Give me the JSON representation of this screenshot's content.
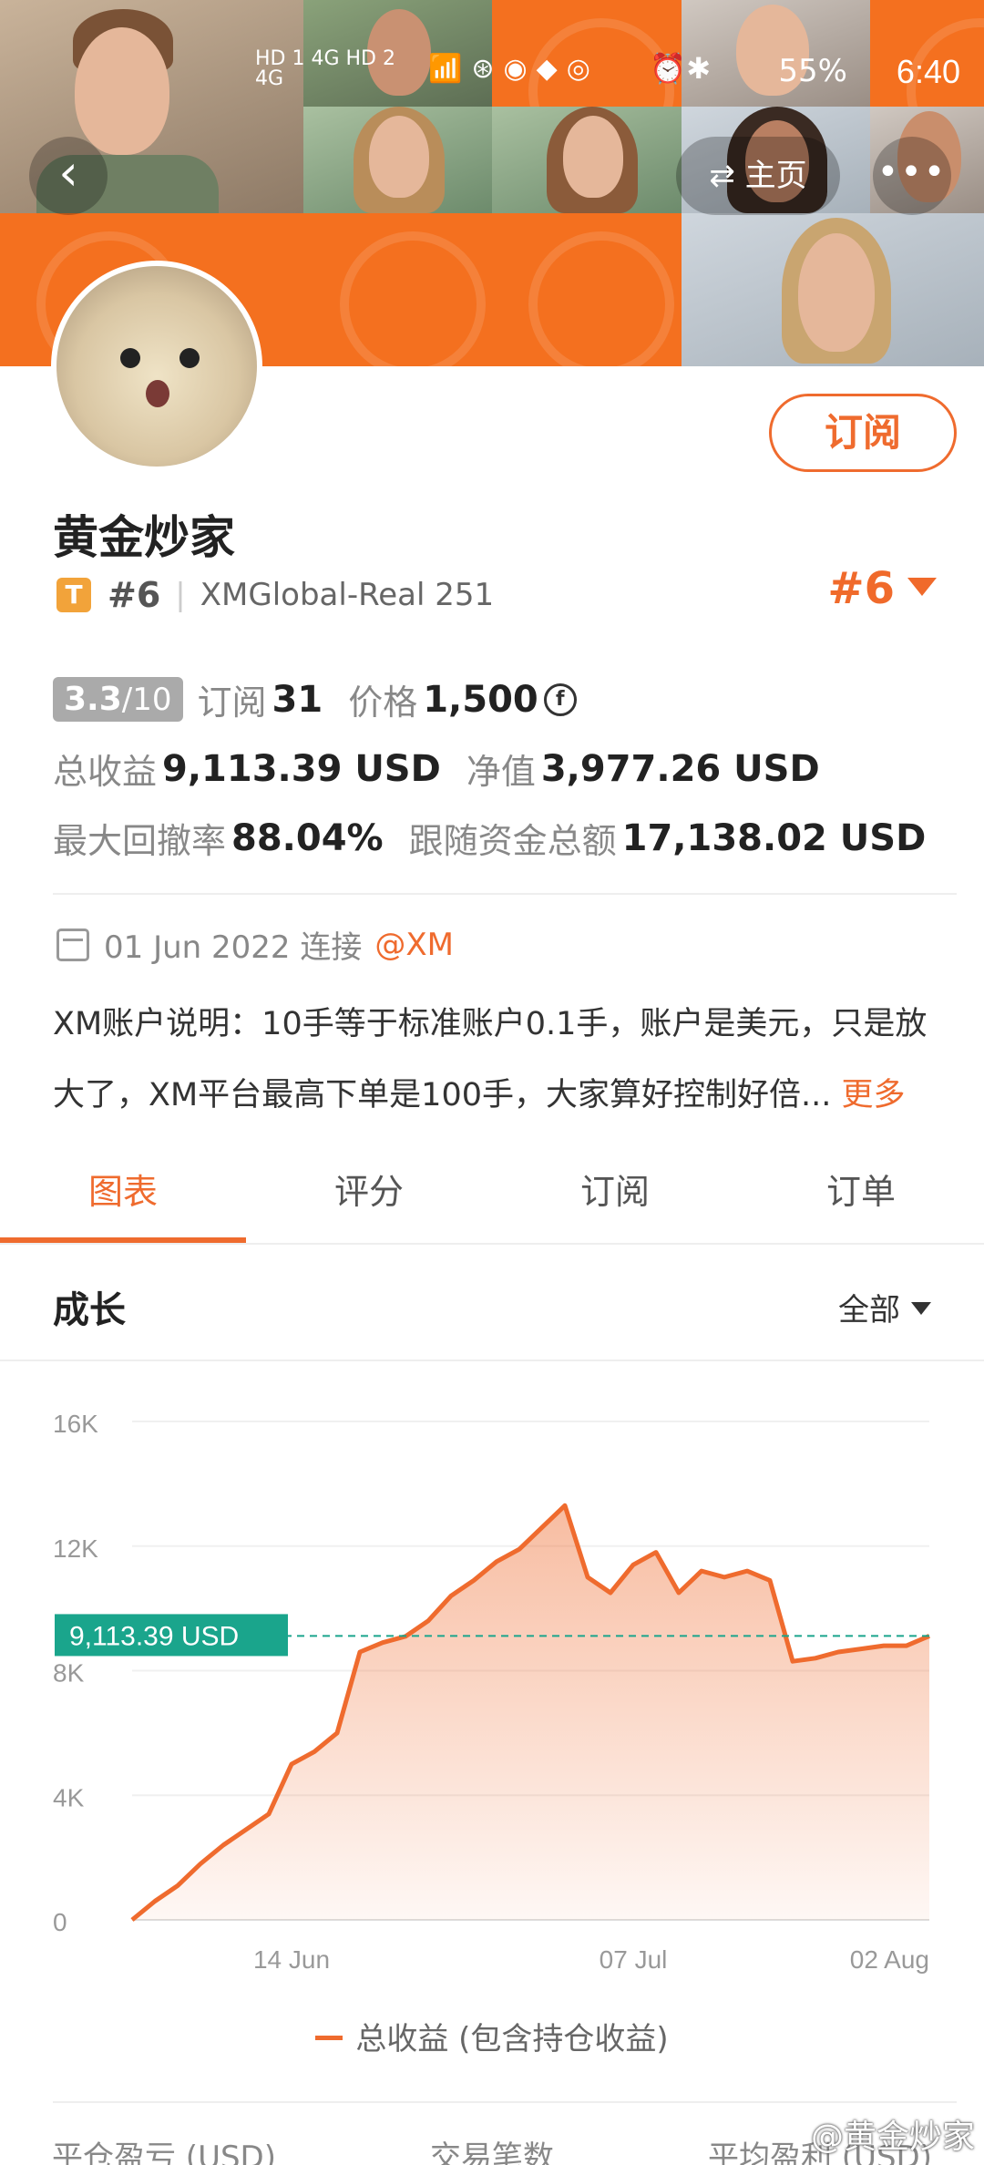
{
  "status_bar": {
    "time": "6:40",
    "battery": "55%",
    "network": "HD 1 4G HD 2 4G"
  },
  "header": {
    "home_label": "主页",
    "subscribe_label": "订阅"
  },
  "profile": {
    "name": "黄金炒家",
    "badge": "T",
    "rank": "#6",
    "account": "XMGlobal-Real 251",
    "rank_right": "#6"
  },
  "stats": {
    "score_main": "3.3",
    "score_total": "/10",
    "subscribe_label": "订阅",
    "subscribe_count": "31",
    "price_label": "价格",
    "price_value": "1,500",
    "price_icon": "f",
    "total_profit_label": "总收益",
    "total_profit_value": "9,113.39 USD",
    "net_value_label": "净值",
    "net_value_value": "3,977.26 USD",
    "max_drawdown_label": "最大回撤率",
    "max_drawdown_value": "88.04%",
    "follow_total_label": "跟随资金总额",
    "follow_total_value": "17,138.02 USD"
  },
  "info": {
    "date": "01 Jun 2022 连接",
    "broker": "@XM",
    "description": "XM账户说明：10手等于标准账户0.1手，账户是美元，只是放大了，XM平台最高下单是100手，大家算好控制好倍...",
    "more": "更多"
  },
  "tabs": [
    "图表",
    "评分",
    "订阅",
    "订单"
  ],
  "section": {
    "title": "成长",
    "filter": "全部"
  },
  "chart_data": {
    "type": "area",
    "title": "",
    "y_ticks": [
      "0",
      "4K",
      "8K",
      "12K",
      "16K"
    ],
    "x_ticks": [
      "14 Jun",
      "07 Jul",
      "02 Aug"
    ],
    "ylim": [
      0,
      16000
    ],
    "current_label": "9,113.39 USD",
    "current_value": 9113.39,
    "color": "#ef6b2e",
    "ref_line_color": "#1aa58c",
    "legend": "总收益 (包含持仓收益)",
    "series": [
      {
        "name": "总收益 (包含持仓收益)",
        "x": [
          "01 Jun",
          "03 Jun",
          "05 Jun",
          "07 Jun",
          "09 Jun",
          "11 Jun",
          "13 Jun",
          "14 Jun",
          "15 Jun",
          "16 Jun",
          "17 Jun",
          "19 Jun",
          "21 Jun",
          "23 Jun",
          "25 Jun",
          "27 Jun",
          "29 Jun",
          "01 Jul",
          "03 Jul",
          "04 Jul",
          "05 Jul",
          "06 Jul",
          "07 Jul",
          "09 Jul",
          "11 Jul",
          "13 Jul",
          "15 Jul",
          "17 Jul",
          "20 Jul",
          "22 Jul",
          "24 Jul",
          "26 Jul",
          "28 Jul",
          "30 Jul",
          "01 Aug",
          "02 Aug"
        ],
        "values": [
          0,
          600,
          1100,
          1800,
          2400,
          2900,
          3400,
          5000,
          5400,
          6000,
          8600,
          8900,
          9100,
          9600,
          10400,
          10900,
          11500,
          11900,
          12600,
          13300,
          11000,
          10500,
          11400,
          11800,
          10500,
          11200,
          11000,
          11200,
          10900,
          8300,
          8400,
          8600,
          8700,
          8800,
          8800,
          9113.39
        ]
      }
    ]
  },
  "bottom_labels": [
    "平仓盈亏 (USD)",
    "交易笔数",
    "平均盈利 (USD)"
  ],
  "watermark": "@黄金炒家"
}
